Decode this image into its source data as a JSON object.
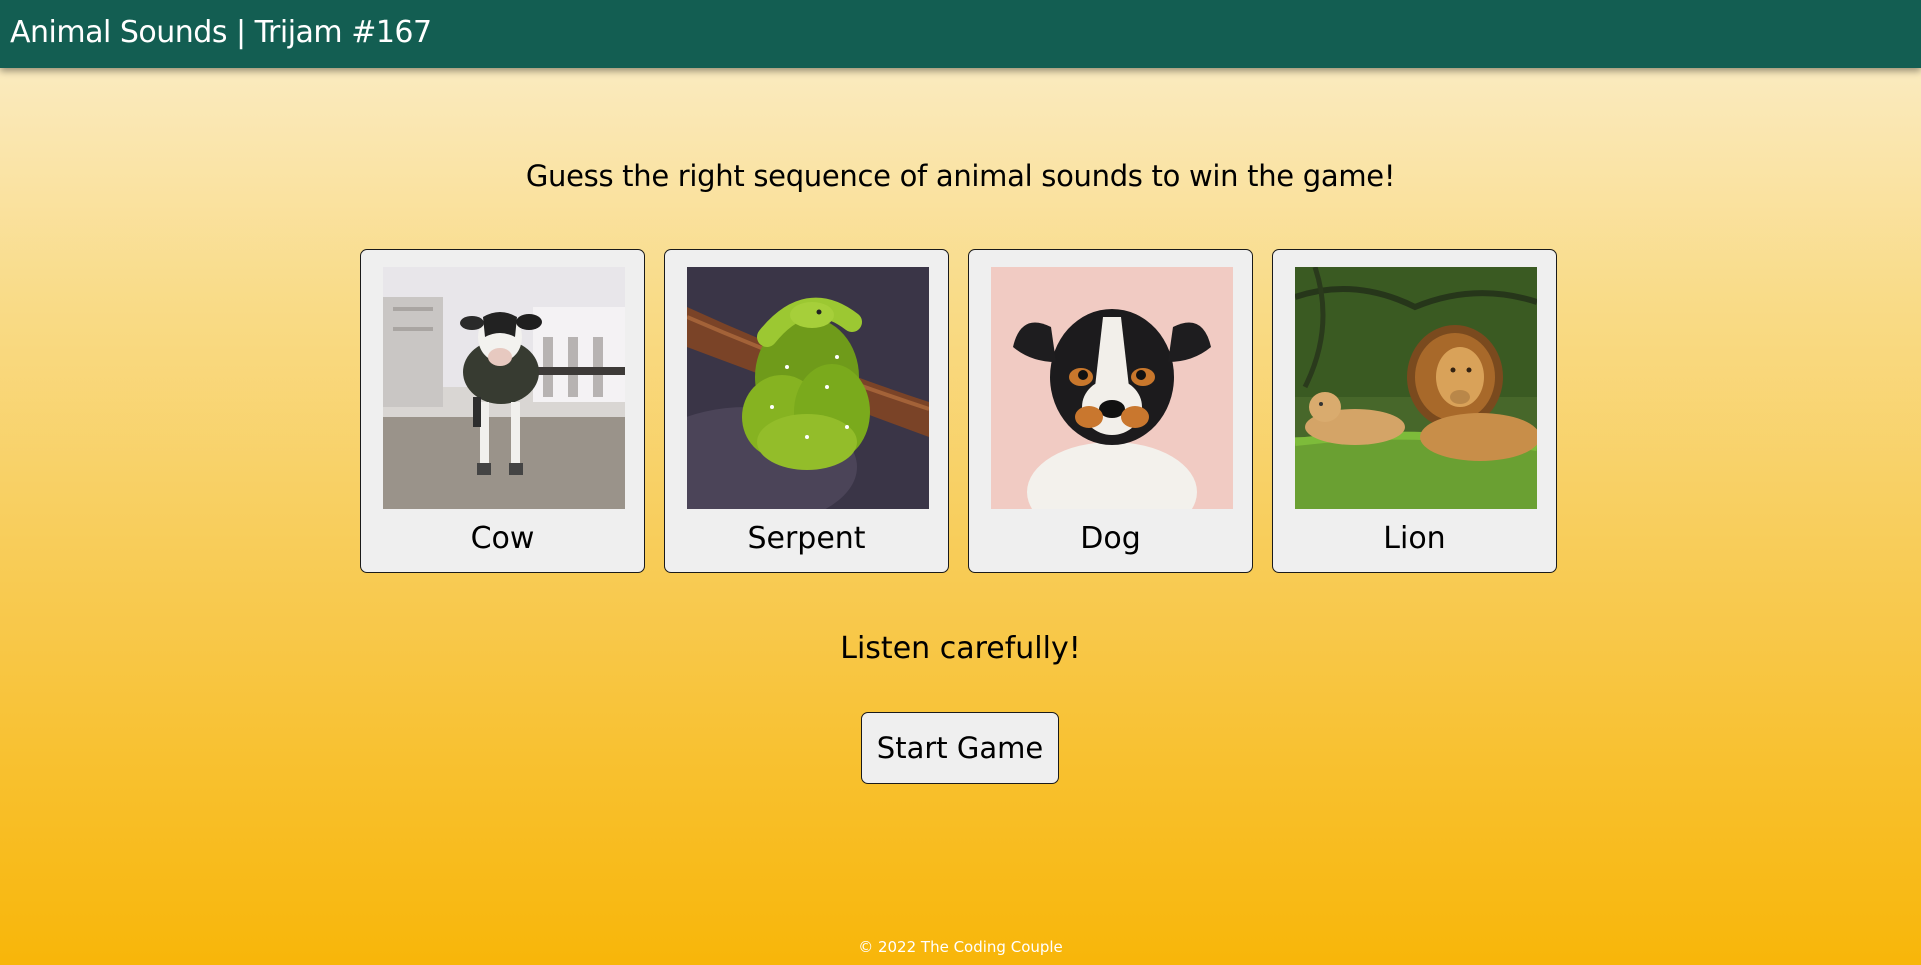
{
  "app": {
    "title": "Animal Sounds | Trijam #167"
  },
  "main": {
    "instruction": "Guess the right sequence of animal sounds to win the game!",
    "status": "Listen carefully!",
    "start_button_label": "Start Game"
  },
  "cards": [
    {
      "label": "Cow"
    },
    {
      "label": "Serpent"
    },
    {
      "label": "Dog"
    },
    {
      "label": "Lion"
    }
  ],
  "footer": {
    "copyright": "© 2022 The Coding Couple"
  },
  "colors": {
    "header_bg": "#135e52",
    "card_bg": "#efefef",
    "gradient_top": "#fbefcf",
    "gradient_bottom": "#f8b609"
  }
}
